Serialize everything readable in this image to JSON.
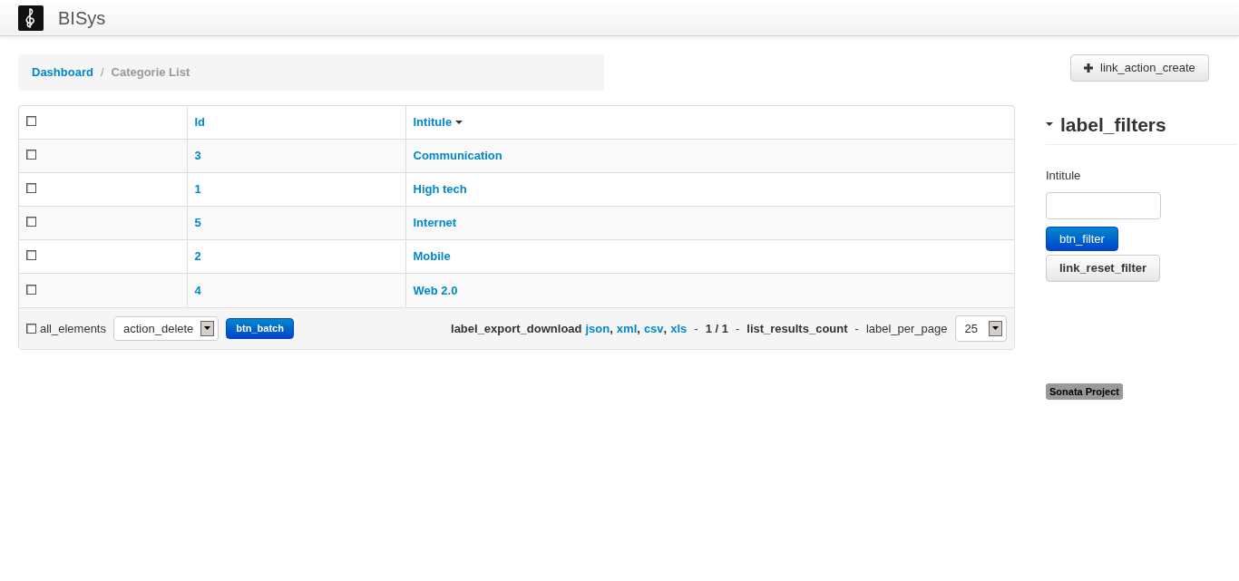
{
  "brand": "BISys",
  "breadcrumb": [
    {
      "label": "Dashboard",
      "link": true
    },
    {
      "divider": "/",
      "label": "Categorie List",
      "link": false
    }
  ],
  "create_button": "link_action_create",
  "table": {
    "header_checked": false,
    "columns": [
      {
        "label": "Id",
        "sorted": false
      },
      {
        "label": "Intitule",
        "sorted": true
      }
    ],
    "rows": [
      {
        "checked": false,
        "id": "3",
        "intitule": "Communication"
      },
      {
        "checked": false,
        "id": "1",
        "intitule": "High tech"
      },
      {
        "checked": false,
        "id": "5",
        "intitule": "Internet"
      },
      {
        "checked": false,
        "id": "2",
        "intitule": "Mobile"
      },
      {
        "checked": false,
        "id": "4",
        "intitule": "Web 2.0"
      }
    ]
  },
  "footer": {
    "all_elements": {
      "label": "all_elements",
      "checked": false
    },
    "batch_action": "action_delete",
    "batch_button": "btn_batch",
    "parts": [
      {
        "kind": "strong",
        "text": "label_export_download"
      },
      {
        "kind": "link",
        "text": "json"
      },
      {
        "kind": "strong",
        "text": ","
      },
      {
        "kind": "link",
        "text": "xml"
      },
      {
        "kind": "strong",
        "text": ","
      },
      {
        "kind": "link",
        "text": "csv"
      },
      {
        "kind": "strong",
        "text": ","
      },
      {
        "kind": "link",
        "text": "xls"
      },
      {
        "kind": "plain",
        "text": "-"
      },
      {
        "kind": "strong",
        "text": "1 / 1"
      },
      {
        "kind": "plain",
        "text": "-"
      },
      {
        "kind": "strong",
        "text": "list_results_count"
      },
      {
        "kind": "plain",
        "text": "-"
      },
      {
        "kind": "plain",
        "text": "label_per_page"
      }
    ],
    "per_page": "25"
  },
  "filters": {
    "title": "label_filters",
    "expanded": true,
    "fields": [
      {
        "label": "Intitule"
      }
    ],
    "filter_button": "btn_filter",
    "reset_button": "link_reset_filter"
  },
  "badge": "Sonata Project"
}
